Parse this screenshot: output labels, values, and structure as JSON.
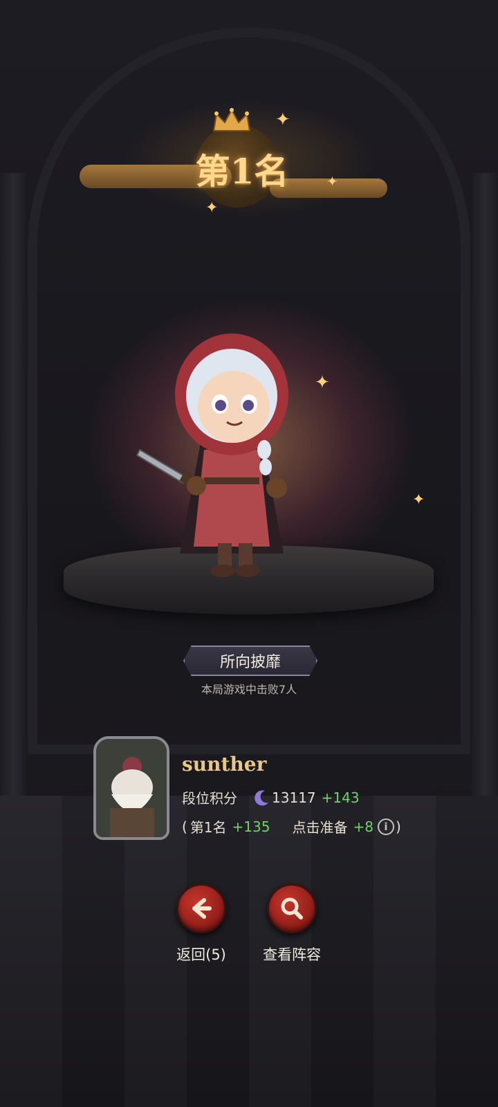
{
  "rank": {
    "title": "第1名"
  },
  "achievement": {
    "title": "所向披靡",
    "subtitle": "本局游戏中击败7人"
  },
  "player": {
    "name": "sunther",
    "rating_label": "段位积分",
    "rating_value": "13117",
    "rating_delta": "+143",
    "breakdown_open": "(",
    "rank_part_label": "第1名",
    "rank_part_delta": "+135",
    "ready_part_label": "点击准备",
    "ready_part_delta": "+8",
    "breakdown_close": ")"
  },
  "actions": {
    "back_label": "返回(5)",
    "view_lineup_label": "查看阵容"
  },
  "colors": {
    "gold": "#ffd890",
    "positive": "#6fd56a",
    "button_red": "#c4362c"
  },
  "icons": [
    "crown-icon",
    "sparkle-icon",
    "moon-rating-icon",
    "info-icon",
    "arrow-left-icon",
    "magnifier-icon"
  ]
}
